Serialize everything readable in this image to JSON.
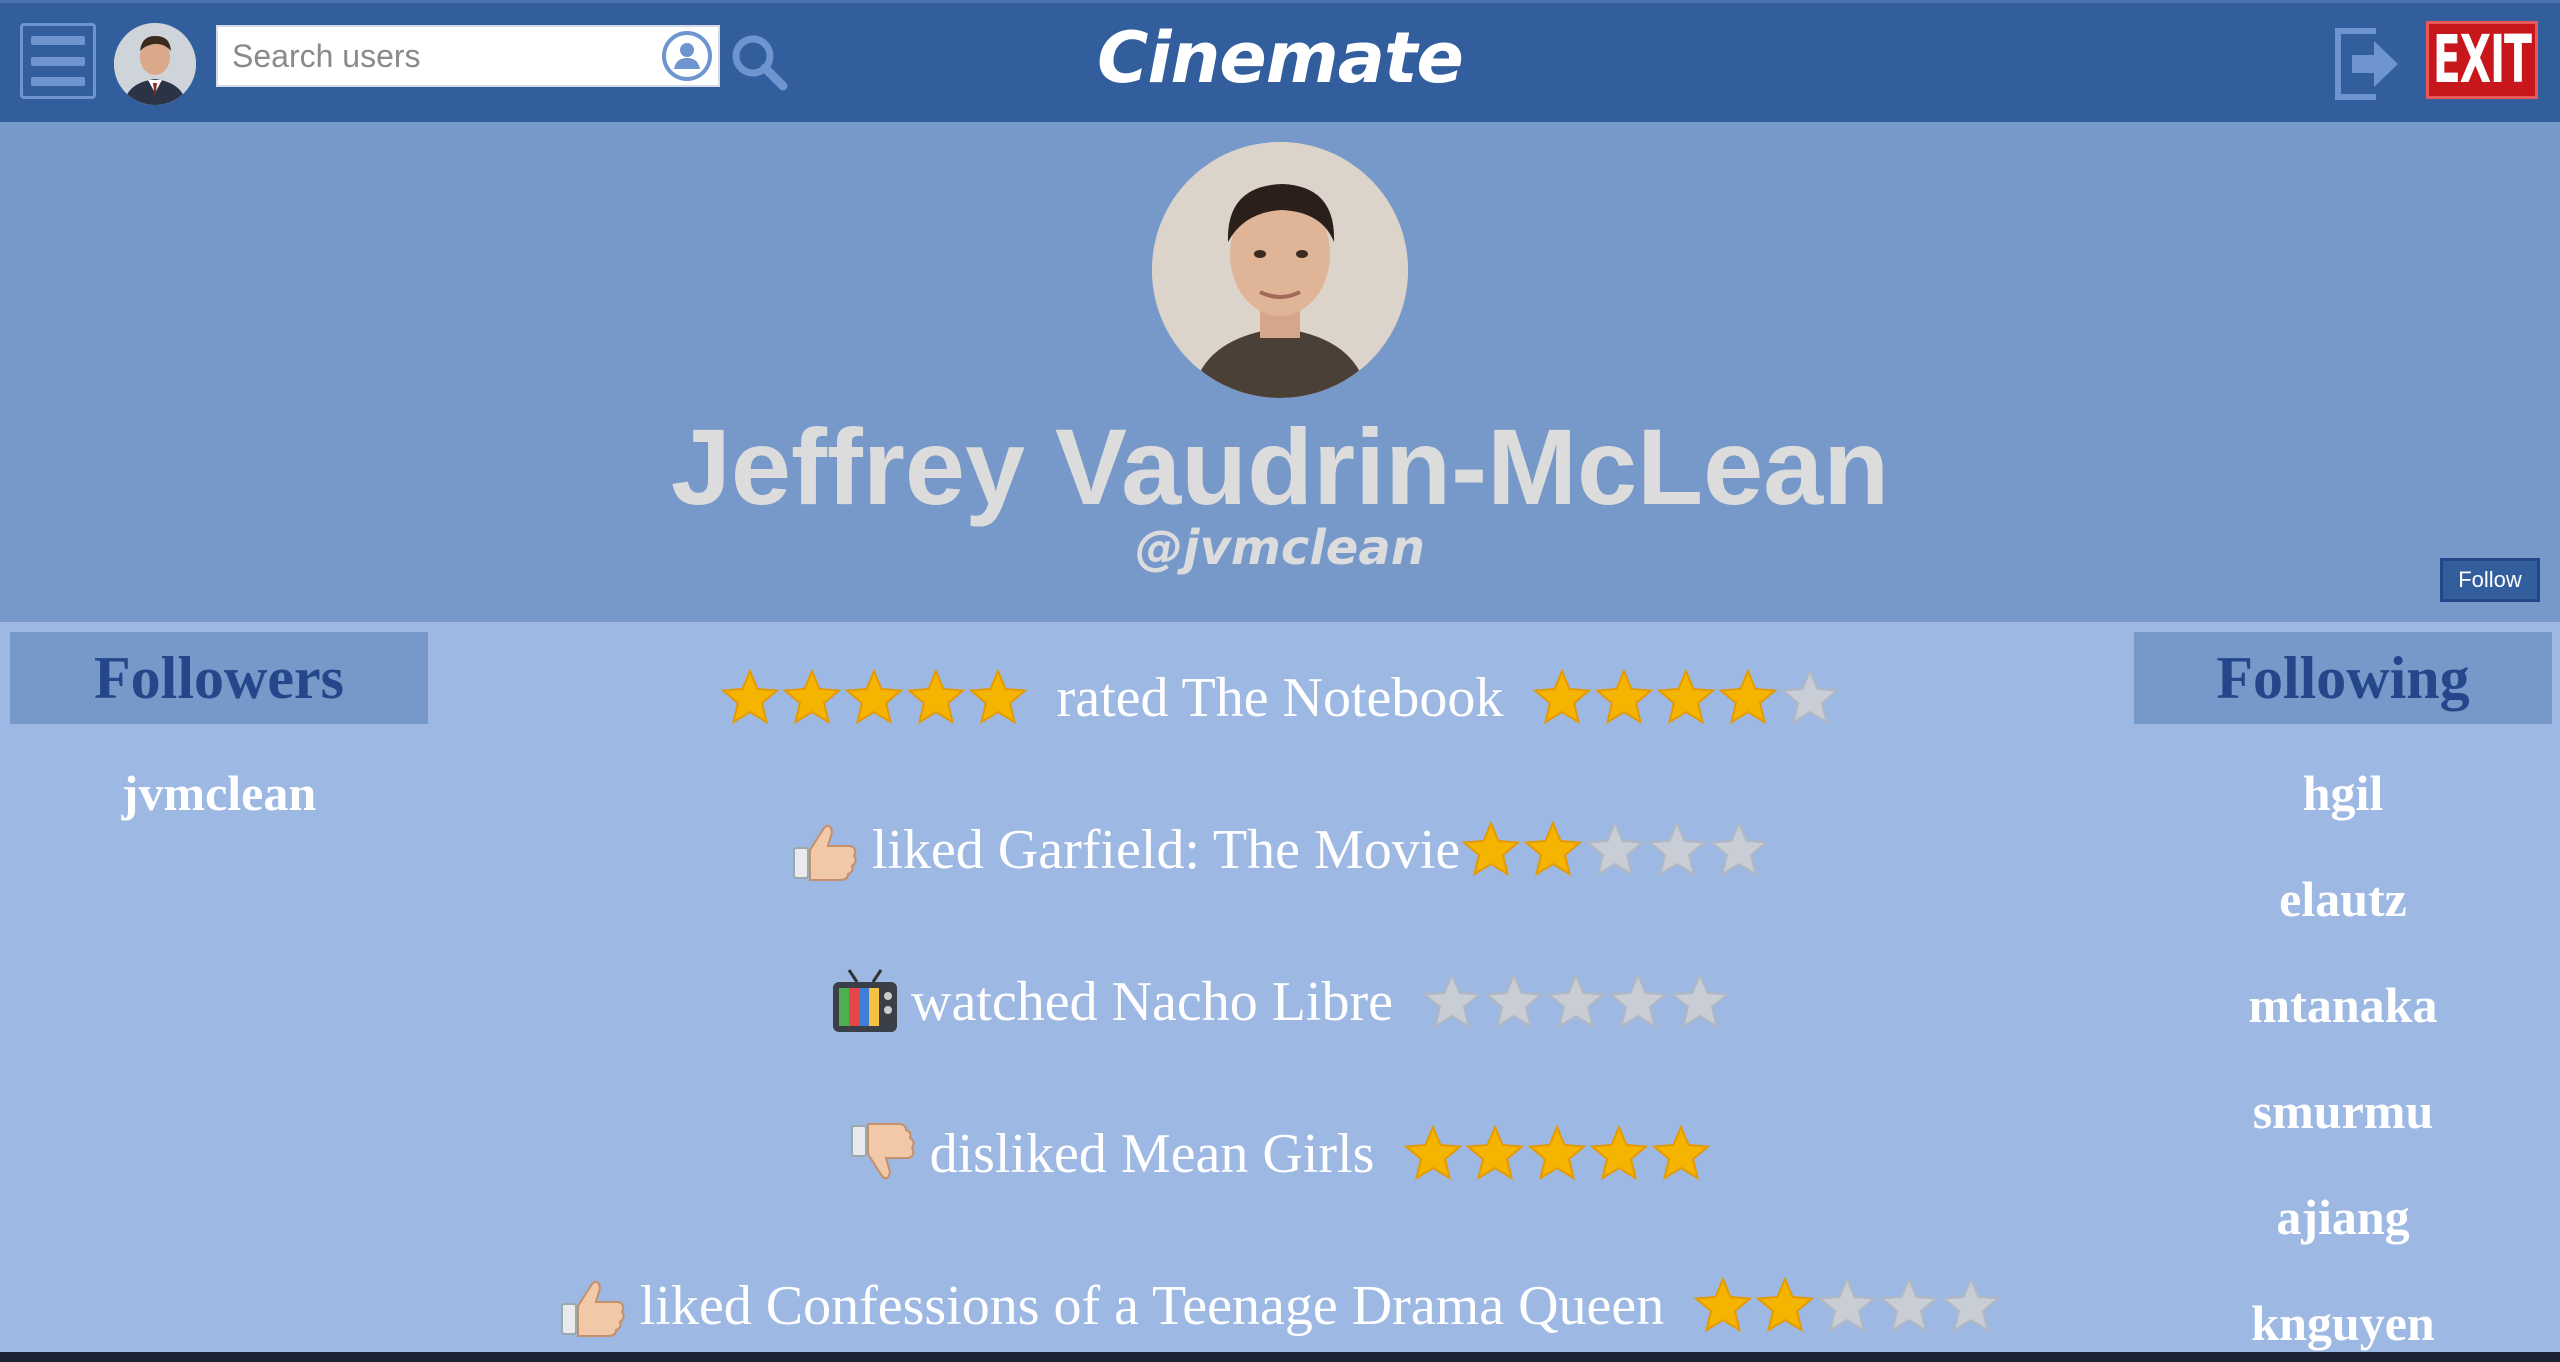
{
  "app": {
    "brand": "Cinemate",
    "exit_label": "EXIT"
  },
  "search": {
    "placeholder": "Search users"
  },
  "icons": {
    "menu": "hamburger-menu-icon",
    "search": "magnifying-glass-icon",
    "user_lookup": "user-circle-icon",
    "logout": "logout-arrow-icon",
    "exit": "exit-sign-icon",
    "like": "thumbs-up-icon",
    "dislike": "thumbs-down-icon",
    "watched": "television-icon",
    "star": "star-icon"
  },
  "colors": {
    "navbar": "#335e9e",
    "header_bg": "#7799c9",
    "content_bg": "#9db8e2",
    "heading_text": "#23478a",
    "star_on": "#f5b400",
    "star_off": "#c9ced6",
    "exit_red": "#c8161d"
  },
  "profile": {
    "name": "Jeffrey Vaudrin-McLean",
    "handle": "@jvmclean",
    "follow_label": "Follow"
  },
  "followers": {
    "title": "Followers",
    "items": [
      "jvmclean"
    ]
  },
  "following": {
    "title": "Following",
    "items": [
      "hgil",
      "elautz",
      "mtanaka",
      "smurmu",
      "ajiang",
      "knguyen"
    ]
  },
  "feed": [
    {
      "action": "rated",
      "text": "rated The Notebook",
      "rating_given": 5,
      "movie_rating": 4,
      "stars_total": 5
    },
    {
      "action": "liked",
      "text": "liked Garfield: The Movie",
      "movie_rating": 2,
      "stars_total": 5
    },
    {
      "action": "watched",
      "text": "watched Nacho Libre",
      "movie_rating": 0,
      "stars_total": 5
    },
    {
      "action": "disliked",
      "text": "disliked Mean Girls",
      "movie_rating": 5,
      "stars_total": 5
    },
    {
      "action": "liked",
      "text": "liked Confessions of a Teenage Drama Queen",
      "movie_rating": 2,
      "stars_total": 5
    }
  ]
}
